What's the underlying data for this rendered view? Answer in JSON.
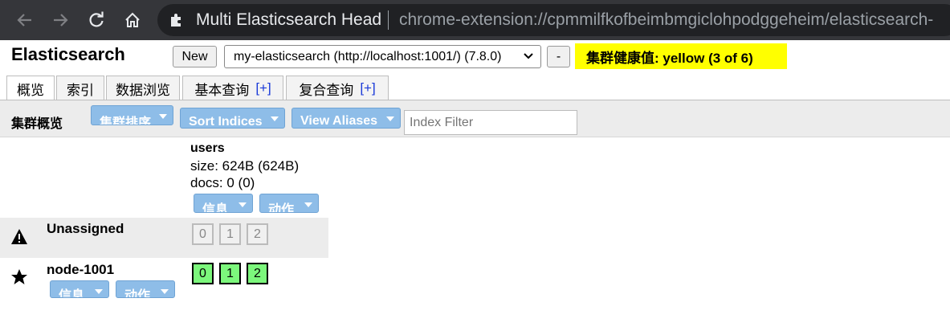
{
  "browser": {
    "tab_title": "Multi Elasticsearch Head",
    "url": "chrome-extension://cpmmilfkofbeimbmgiclohpodggeheim/elasticsearch-"
  },
  "header": {
    "app_title": "Elasticsearch",
    "new_label": "New",
    "cluster_selected": "my-elasticsearch (http://localhost:1001/) (7.8.0)",
    "remove_label": "-",
    "health_text": "集群健康值: yellow (3 of 6)",
    "health_color": "#ffff00"
  },
  "tabs": [
    {
      "label": "概览",
      "plus": ""
    },
    {
      "label": "索引",
      "plus": ""
    },
    {
      "label": "数据浏览",
      "plus": ""
    },
    {
      "label": "基本查询",
      "plus": "[+]"
    },
    {
      "label": "复合查询",
      "plus": "[+]"
    }
  ],
  "toolbar": {
    "title": "集群概览",
    "sort_cluster": "集群排序",
    "sort_indices": "Sort Indices",
    "view_aliases": "View Aliases",
    "filter_placeholder": "Index Filter",
    "accent": "#8ebde8"
  },
  "index": {
    "name": "users",
    "size": "size: 624B (624B)",
    "docs": "docs: 0 (0)",
    "info_label": "信息",
    "action_label": "动作"
  },
  "rows": {
    "unassigned": {
      "icon": "warning-icon",
      "name": "Unassigned",
      "shards": [
        "0",
        "1",
        "2"
      ]
    },
    "node": {
      "icon": "star-icon",
      "name": "node-1001",
      "info_label": "信息",
      "action_label": "动作",
      "shards": [
        "0",
        "1",
        "2"
      ],
      "shard_color": "#7cf77c"
    }
  }
}
